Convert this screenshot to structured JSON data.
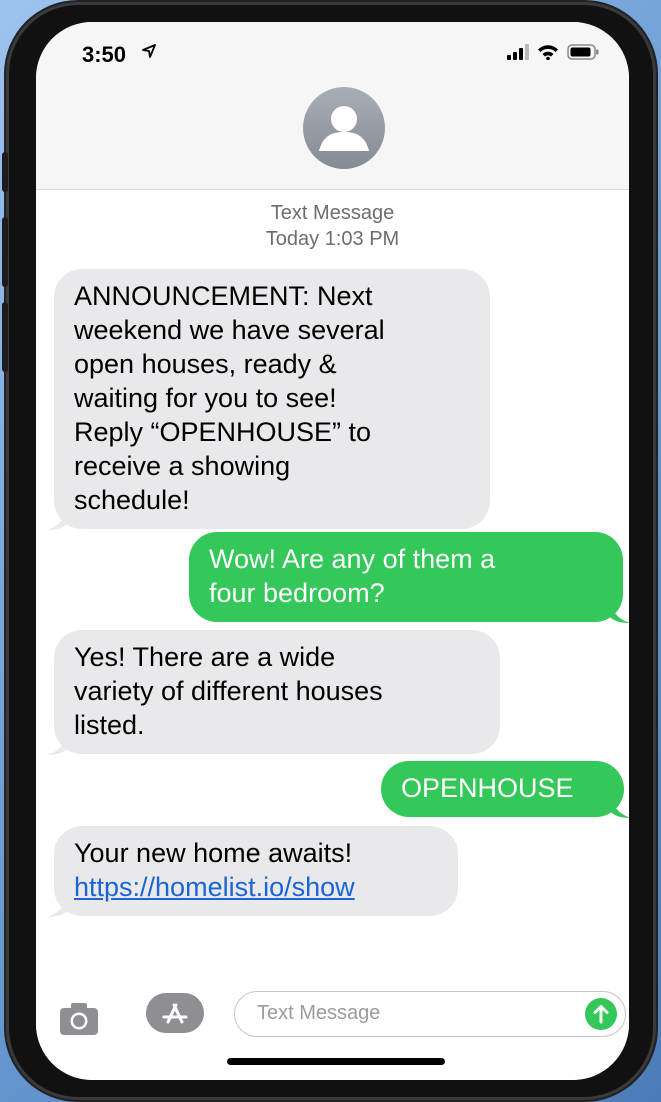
{
  "status_bar": {
    "time": "3:50"
  },
  "thread": {
    "service_label": "Text Message",
    "timestamp": "Today 1:03 PM"
  },
  "messages": [
    {
      "direction": "incoming",
      "lines": [
        "ANNOUNCEMENT: Next",
        "weekend we have several",
        "open houses, ready &",
        "waiting for you to see!",
        "Reply “OPENHOUSE” to",
        "receive a showing",
        "schedule!"
      ]
    },
    {
      "direction": "outgoing",
      "lines": [
        "Wow! Are any of them a",
        "four bedroom?"
      ]
    },
    {
      "direction": "incoming",
      "lines": [
        "Yes! There are a wide",
        "variety of different houses",
        "listed."
      ]
    },
    {
      "direction": "outgoing",
      "lines": [
        "OPENHOUSE"
      ]
    },
    {
      "direction": "incoming",
      "lines": [
        "Your new home awaits!"
      ],
      "link": "https://homelist.io/show"
    }
  ],
  "composer": {
    "placeholder": "Text Message"
  },
  "icons": {
    "location": "location-arrow-icon",
    "signal": "cellular-signal-icon",
    "wifi": "wifi-icon",
    "battery": "battery-icon",
    "avatar": "contact-avatar-icon",
    "camera": "camera-icon",
    "apps": "app-store-icon",
    "send": "send-arrow-icon"
  },
  "colors": {
    "incoming_bubble": "#e9e9eb",
    "outgoing_bubble": "#34c759",
    "link": "#1a64d6"
  }
}
